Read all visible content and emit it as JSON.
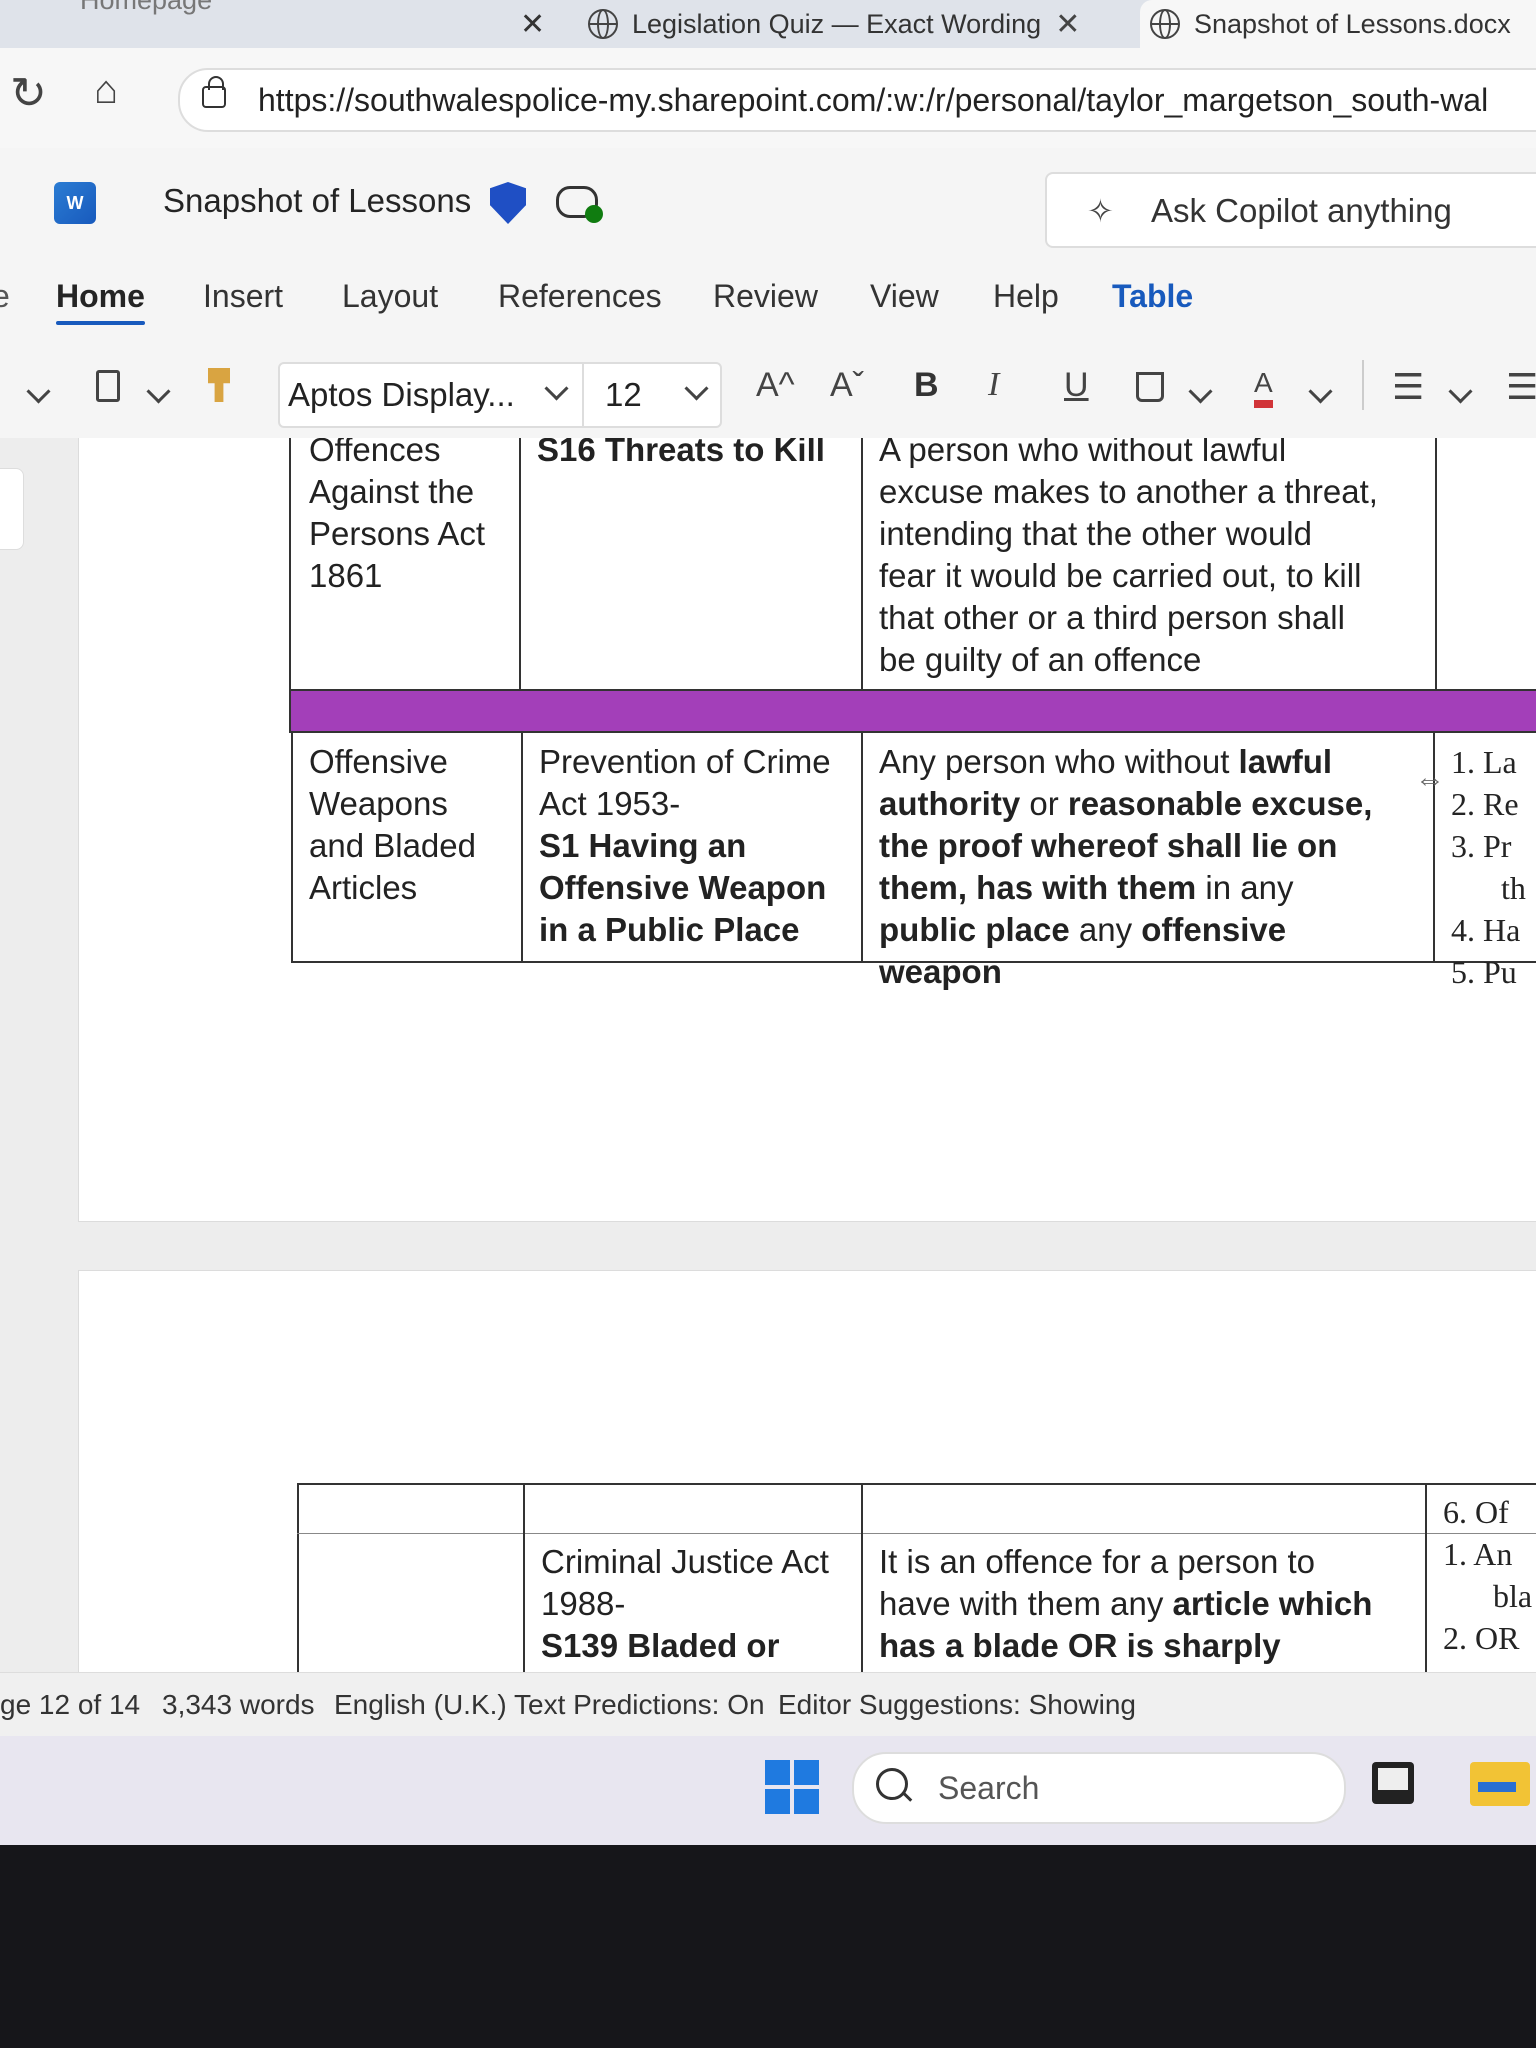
{
  "tabs": [
    {
      "label": "Homepage"
    },
    {
      "label": "Legislation Quiz — Exact Wording"
    },
    {
      "label": "Snapshot of Lessons.docx"
    }
  ],
  "address": {
    "url": "https://southwalespolice-my.sharepoint.com/:w:/r/personal/taylor_margetson_south-wal"
  },
  "app": {
    "logo_text": "W",
    "doc_title": "Snapshot of Lessons",
    "copilot_placeholder": "Ask Copilot anything"
  },
  "menu": [
    "Home",
    "Insert",
    "Layout",
    "References",
    "Review",
    "View",
    "Help",
    "Table"
  ],
  "ribbon": {
    "font_name": "Aptos Display...",
    "font_size": "12",
    "grow": "A^",
    "shrink": "Aˇ",
    "bold": "B",
    "italic": "I",
    "underline": "U",
    "font_color": "A"
  },
  "table1": {
    "row1": {
      "col1": [
        "Offences",
        "Against the",
        "Persons Act",
        "1861"
      ],
      "col2": "S16 Threats to Kill",
      "col3": [
        "A person who without lawful",
        "excuse makes to another a threat,",
        "intending that the other would",
        "fear it would be carried out, to kill",
        "that other or a third person shall",
        "be guilty of an offence"
      ]
    },
    "row2": {
      "col1": [
        "Offensive",
        "Weapons",
        "and Bladed",
        "Articles"
      ],
      "col2_plain": [
        "Prevention of Crime",
        "Act 1953-"
      ],
      "col2_bold": [
        "S1 Having an",
        "Offensive Weapon",
        "in a Public Place"
      ],
      "col3": {
        "l1a": "Any person who without ",
        "l1b": "lawful",
        "l2a": "authority",
        "l2b": " or ",
        "l2c": "reasonable excuse,",
        "l3": "the proof whereof shall lie on",
        "l4a": "them, has with them",
        "l4b": " in any",
        "l5a": "public place",
        "l5b": " any ",
        "l5c": "offensive",
        "l6": "weapon"
      },
      "col4": [
        "1. La",
        "2. Re",
        "3. Pr",
        "th",
        "4. Ha",
        "5. Pu"
      ]
    },
    "row_band_color": "#a33fb9"
  },
  "table2": {
    "col2_plain": [
      "Criminal Justice Act",
      "1988-"
    ],
    "col2_bold": "S139 Bladed or",
    "col3": {
      "l1": "It is an offence for a person to",
      "l2a": "have with them any ",
      "l2b": "article which",
      "l3": "has a blade OR is sharply"
    },
    "col4_top": "6. Of",
    "col4": [
      "1. An",
      "bla",
      "2. OR"
    ]
  },
  "status": {
    "page": "ge 12 of 14",
    "words": "3,343 words",
    "language": "English (U.K.)",
    "predictions": "Text Predictions: On",
    "editor": "Editor Suggestions: Showing"
  },
  "taskbar": {
    "search_label": "Search"
  },
  "colors": {
    "accent": "#185abd",
    "purple_band": "#a33fb9"
  }
}
